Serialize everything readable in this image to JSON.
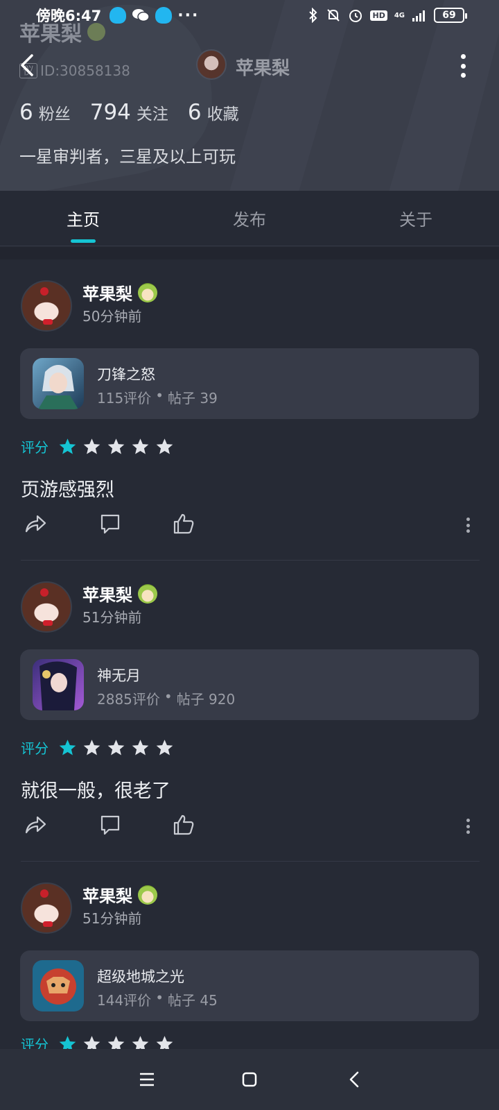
{
  "status_bar": {
    "time": "傍晚6:47",
    "battery": "69",
    "signal_label": "4G",
    "hd_label": "HD",
    "dots": "···"
  },
  "profile": {
    "name": "苹果梨",
    "badge_label": "仪",
    "id_text": "ID:30858138",
    "nav_title": "苹果梨",
    "stats": [
      {
        "num": "6",
        "label": "粉丝"
      },
      {
        "num": "794",
        "label": "关注"
      },
      {
        "num": "6",
        "label": "收藏"
      }
    ],
    "bio": "一星审判者，三星及以上可玩"
  },
  "tabs": [
    {
      "label": "主页",
      "active": true
    },
    {
      "label": "发布",
      "active": false
    },
    {
      "label": "关于",
      "active": false
    }
  ],
  "posts": [
    {
      "user": "苹果梨",
      "time": "50分钟前",
      "game": {
        "name": "刀锋之怒",
        "reviews": "115评价",
        "sep": "•",
        "posts": "帖子 39"
      },
      "rating_label": "评分",
      "rating": 1,
      "text": "页游感强烈"
    },
    {
      "user": "苹果梨",
      "time": "51分钟前",
      "game": {
        "name": "神无月",
        "reviews": "2885评价",
        "sep": "•",
        "posts": "帖子 920"
      },
      "rating_label": "评分",
      "rating": 1,
      "text": "就很一般，很老了"
    },
    {
      "user": "苹果梨",
      "time": "51分钟前",
      "game": {
        "name": "超级地城之光",
        "reviews": "144评价",
        "sep": "•",
        "posts": "帖子 45"
      },
      "rating_label": "评分",
      "rating": 1,
      "text": ""
    }
  ],
  "colors": {
    "accent": "#15c4d3",
    "background": "#262a35",
    "card": "#373b48",
    "header": "#3a3e4a"
  },
  "icons": {
    "back": "chevron-left-icon",
    "more": "more-vertical-icon",
    "share": "share-icon",
    "comment": "comment-icon",
    "like": "thumbs-up-icon",
    "star": "star-icon",
    "sys_menu": "menu-icon",
    "sys_home": "home-square-icon",
    "sys_back": "back-chevron-icon"
  }
}
